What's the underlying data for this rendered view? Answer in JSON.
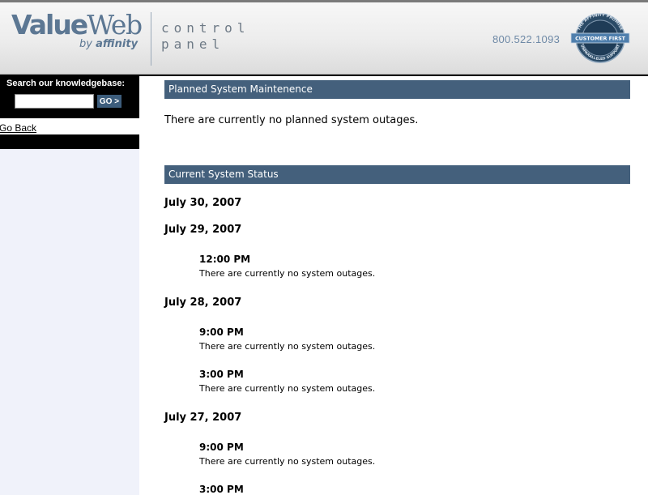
{
  "header": {
    "logo_main_a": "Value",
    "logo_main_b": "Web",
    "logo_sub_a": "by",
    "logo_sub_b": "affinity",
    "product_line1": "control",
    "product_line2": "panel",
    "phone": "800.522.1093",
    "badge_top": "THE AFFINITY PROMISE",
    "badge_center": "CUSTOMER FIRST",
    "badge_bottom": "UNPARALLELED SUPPORT"
  },
  "sidebar": {
    "search_label": "Search our knowledgebase:",
    "search_value": "",
    "go_label": "GO >",
    "go_back": "Go Back"
  },
  "main": {
    "planned_header": "Planned System Maintenence",
    "planned_text": "There are currently no planned system outages.",
    "status_header": "Current System Status",
    "dates": [
      {
        "date": "July 30, 2007",
        "entries": []
      },
      {
        "date": "July 29, 2007",
        "entries": [
          {
            "time": "12:00 PM",
            "message": "There are currently no system outages."
          }
        ]
      },
      {
        "date": "July 28, 2007",
        "entries": [
          {
            "time": "9:00 PM",
            "message": "There are currently no system outages."
          },
          {
            "time": "3:00 PM",
            "message": "There are currently no system outages."
          }
        ]
      },
      {
        "date": "July 27, 2007",
        "entries": [
          {
            "time": "9:00 PM",
            "message": "There are currently no system outages."
          },
          {
            "time": "3:00 PM",
            "message": ""
          }
        ]
      }
    ]
  },
  "colors": {
    "section_header_bg": "#44607c",
    "brand": "#5c7793",
    "sidebar_bg": "#f0f2fa"
  }
}
